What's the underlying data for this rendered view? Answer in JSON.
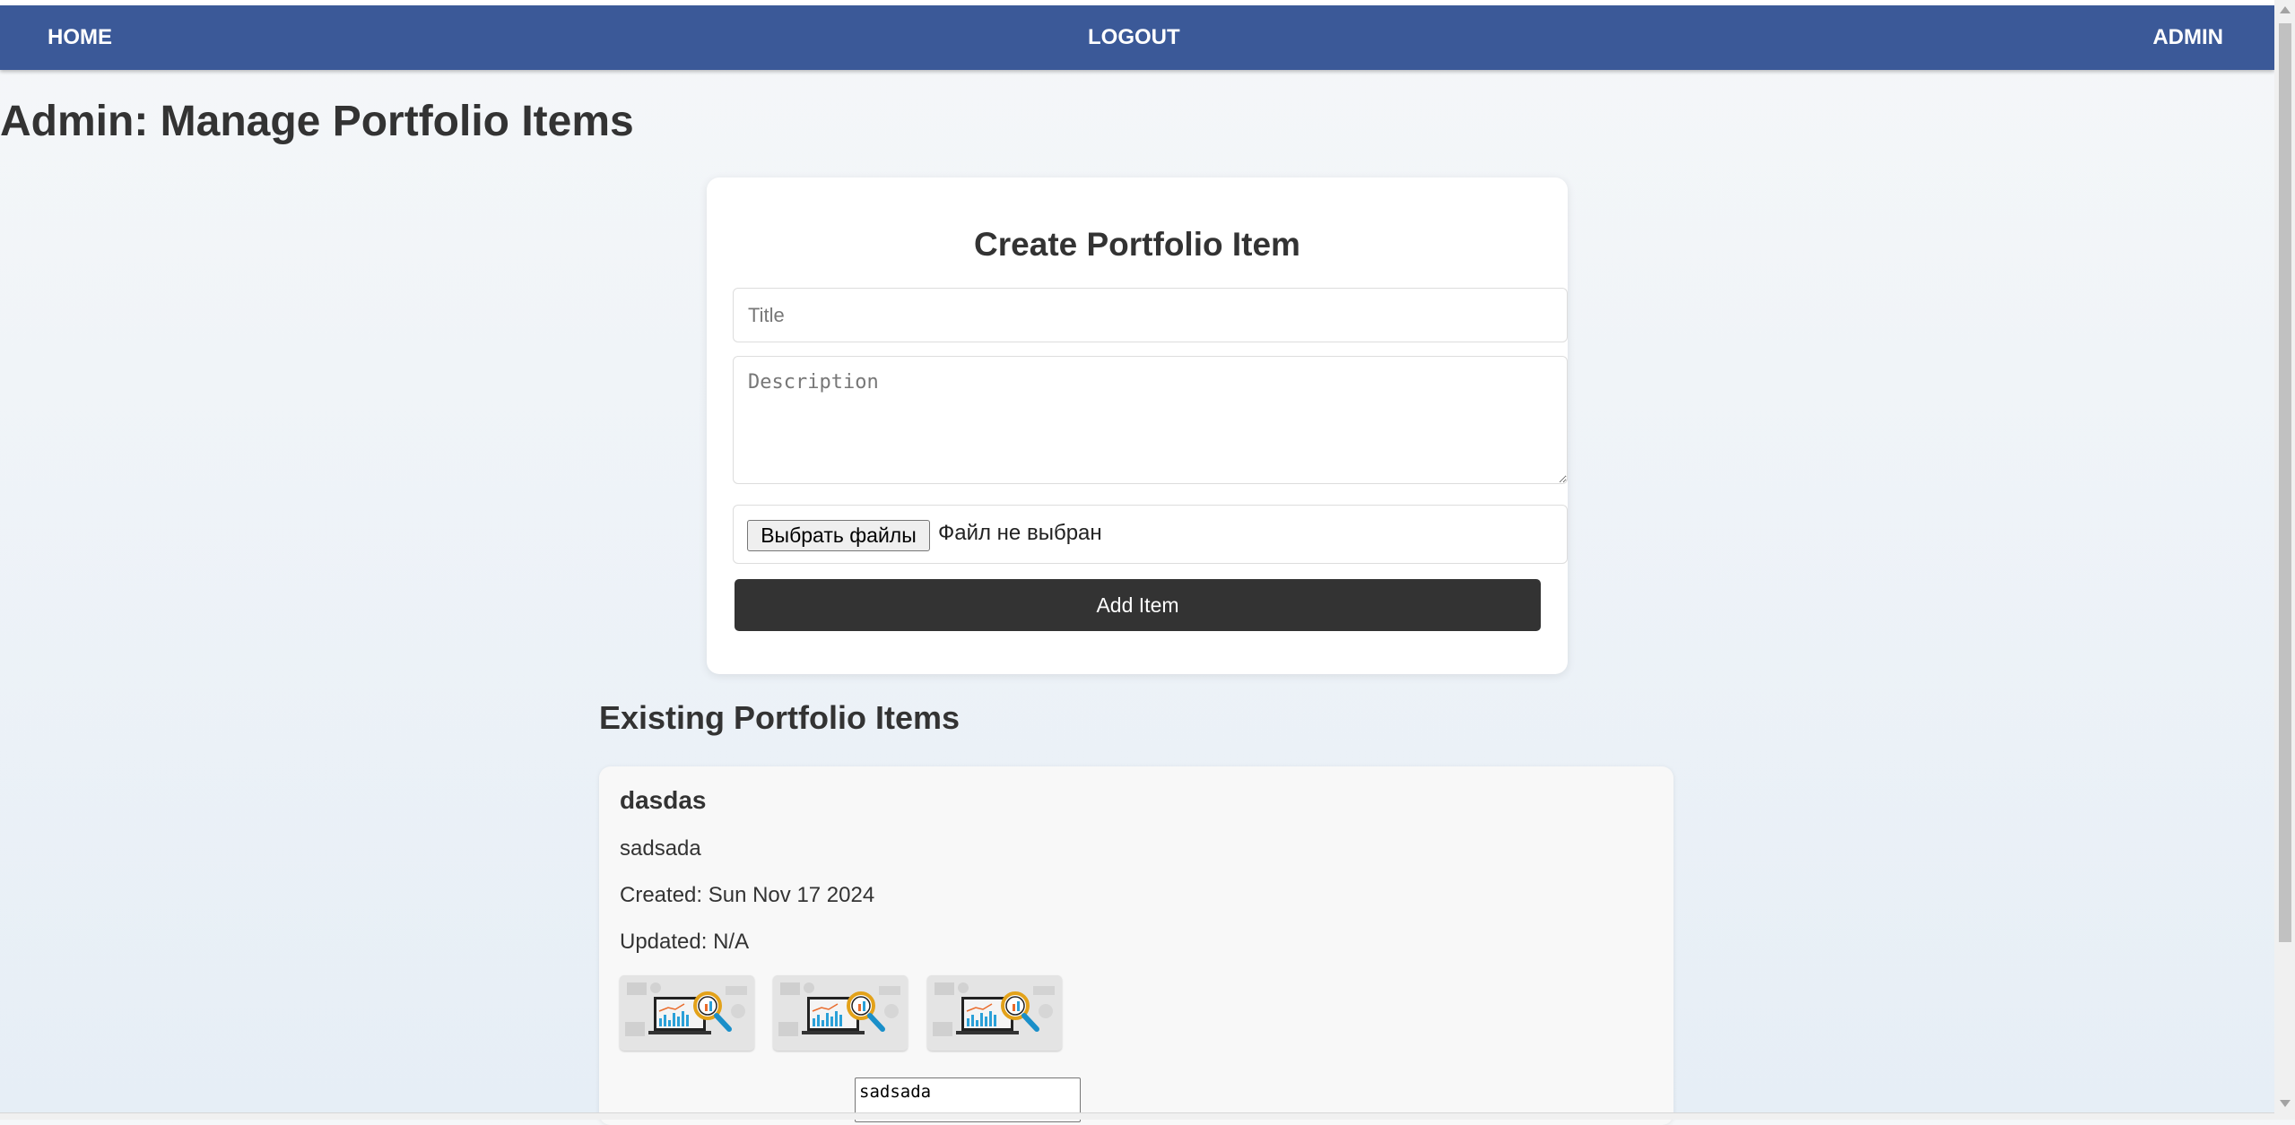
{
  "nav": {
    "home": "HOME",
    "logout": "LOGOUT",
    "admin": "ADMIN",
    "background_color": "#3b5998"
  },
  "page": {
    "title": "Admin: Manage Portfolio Items"
  },
  "create_form": {
    "heading": "Create Portfolio Item",
    "title_placeholder": "Title",
    "description_placeholder": "Description",
    "file_button_label": "Выбрать файлы",
    "file_status": "Файл не выбран",
    "submit_label": "Add Item",
    "submit_color": "#333333"
  },
  "existing": {
    "heading": "Existing Portfolio Items",
    "items": [
      {
        "title": "dasdas",
        "description": "sadsada",
        "created": "Created: Sun Nov 17 2024",
        "updated": "Updated: N/A",
        "images": [
          "analytics-laptop-magnifier-image",
          "analytics-laptop-magnifier-image",
          "analytics-laptop-magnifier-image"
        ],
        "edit_description_value": "sadsada"
      }
    ]
  }
}
